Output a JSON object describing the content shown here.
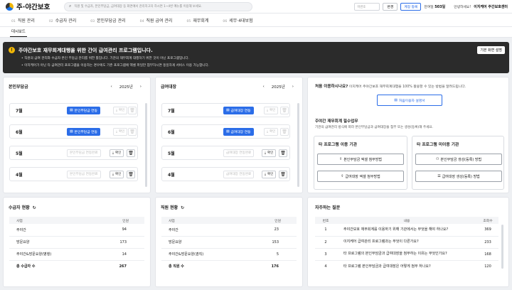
{
  "header": {
    "logo_text": "주·야간보호",
    "search_placeholder": "직원 및 수급자, 본인부담금, 급여대장 등 화면에서 관리하고자 하시면 1~4번 메뉴를 이용해 보세요.",
    "small_input_placeholder": "이번호",
    "change_btn": "변경",
    "account_btn": "계정 등록",
    "remaining_label": "잔여일",
    "remaining_value": "503일",
    "greeting": "안녕하세요!",
    "center_name": "이지케어 주간보호센터"
  },
  "nav": [
    {
      "num": "01",
      "label": "직원 관리"
    },
    {
      "num": "02",
      "label": "수급자 관리"
    },
    {
      "num": "03",
      "label": "본인부담금 관리"
    },
    {
      "num": "04",
      "label": "직원 급여 관리"
    },
    {
      "num": "05",
      "label": "재무회계"
    },
    {
      "num": "06",
      "label": "세무·4대보험"
    }
  ],
  "subnav": {
    "active_tab": "대시보드"
  },
  "notice": {
    "icon": "!",
    "title": "주야간보호 재무회계대행을 위한 간이 급여관리 프로그램입니다.",
    "line1": "직원의 급여 관리와 수급자 본인 부담금 관리를 위한 툴입니다. 기관의 재무회계 대행하기 위한 것이 아닌 프로그램입니다.",
    "line2": "이지케어가 아닌 타 급여관리 프로그램을 이용하는 경우에도 기존 프로그램에 엑셀 파일만 첨부하시면 동일하게 서비스 이용 가능합니다.",
    "help_btn": "기본 화면 설명"
  },
  "copay": {
    "title": "본인부담금",
    "year": "2025년",
    "prev": "‹",
    "next": "›",
    "rows": [
      {
        "month": "7월",
        "action": "본인부담금 연동",
        "confirm": "확인",
        "linked": true
      },
      {
        "month": "6월",
        "action": "본인부담금 연동",
        "confirm": "확인",
        "linked": true
      },
      {
        "month": "5월",
        "action": "본인부담금 연동완료",
        "confirm": "확인",
        "linked": false
      },
      {
        "month": "4월",
        "action": "본인부담금 연동완료",
        "confirm": "확인",
        "linked": false
      }
    ]
  },
  "payroll": {
    "title": "급여대장",
    "year": "2025년",
    "prev": "‹",
    "next": "›",
    "rows": [
      {
        "month": "7월",
        "action": "급여대장 연동",
        "confirm": "확인",
        "linked": true
      },
      {
        "month": "6월",
        "action": "급여대장 연동",
        "confirm": "확인",
        "linked": true
      },
      {
        "month": "5월",
        "action": "급여대장 연동완료",
        "confirm": "확인",
        "linked": false
      },
      {
        "month": "4월",
        "action": "급여대장 연동완료",
        "confirm": "확인",
        "linked": false
      }
    ]
  },
  "guide": {
    "first_use_title": "처음 이용하시나요?",
    "first_use_desc": "이지케어 주야간보호 재무회계대행을 100% 활용할 수 있는 방법을 알려드립니다.",
    "first_use_btn": "처음이용자 설명서",
    "duty_title": "주야간 재무회계 필수업무",
    "duty_desc": "기관의 급여관리 방식에 따라 본인부담금과 급여대장을 첨부 또는 생성(등록)해 주세요.",
    "other_title": "타 프로그램 이용 기관",
    "other_btn1": "본인부담금 엑셀 첨부방법",
    "other_btn2": "급여대장 엑셀 첨부방법",
    "nonuse_title": "타 프로그램 미이용 기관",
    "nonuse_btn1": "본인부담금 생성(등록) 방법",
    "nonuse_btn2": "급여대장 생성(등록) 방법"
  },
  "recipients": {
    "title": "수급자 현황",
    "col1": "사업",
    "col2": "인원",
    "rows": [
      {
        "name": "주야간",
        "count": "94"
      },
      {
        "name": "방문요양",
        "count": "173"
      },
      {
        "name": "주야간&방문요양(병행)",
        "count": "14"
      }
    ],
    "total_label": "총 수급자 수",
    "total": "267"
  },
  "staff": {
    "title": "직원 현황",
    "col1": "사업",
    "col2": "인원",
    "rows": [
      {
        "name": "주야간",
        "count": "23"
      },
      {
        "name": "방문요양",
        "count": "153"
      },
      {
        "name": "주야간&방문요양(겸직)",
        "count": "5"
      }
    ],
    "total_label": "총 직원 수",
    "total": "176"
  },
  "faq": {
    "title": "자주하는 질문",
    "col_no": "번호",
    "col_content": "내용",
    "col_views": "조회수",
    "rows": [
      {
        "no": "1",
        "text": "주야간보호 재무회계를 이용하기 위해 기관에서는 무엇을 해야 하나요?",
        "views": "369"
      },
      {
        "no": "2",
        "text": "이지케어 급여관리 프로그램과는 무엇이 다른가요?",
        "views": "233"
      },
      {
        "no": "3",
        "text": "타 프로그램의 본인부담금과 급여대장을 첨부하는 이유는 무엇인가요?",
        "views": "168"
      },
      {
        "no": "4",
        "text": "타 프로그램 본인부담금과 급여대장은 어떻게 첨부 하나요?",
        "views": "120"
      }
    ]
  }
}
